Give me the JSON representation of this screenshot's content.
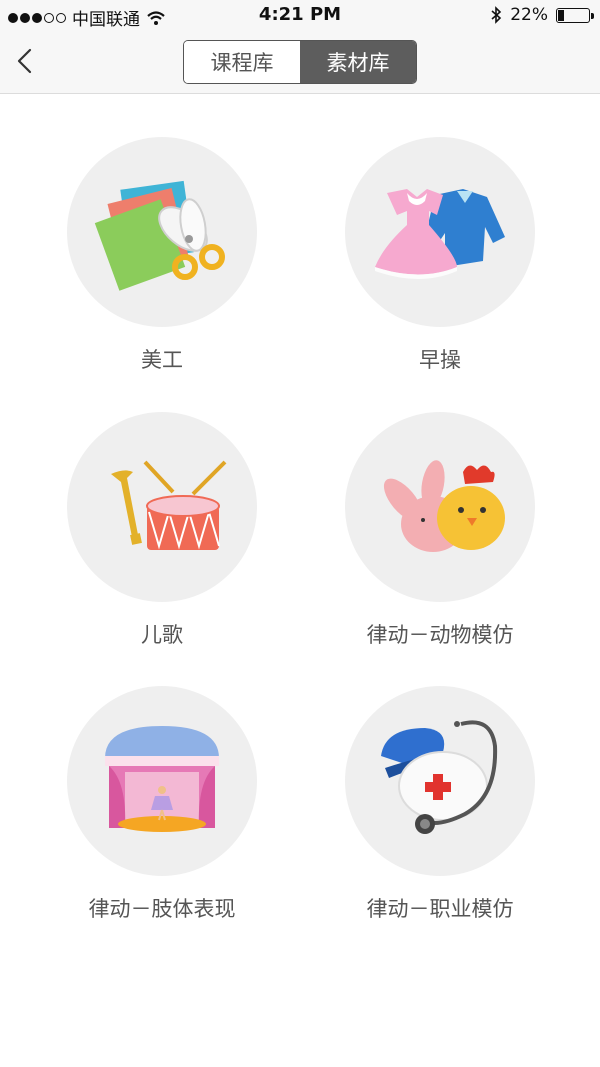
{
  "status_bar": {
    "carrier": "中国联通",
    "time": "4:21 PM",
    "battery": "22%",
    "battery_level": 0.22,
    "icons": [
      "signal-dots-icon",
      "wifi-icon",
      "bluetooth-icon",
      "battery-icon"
    ]
  },
  "nav": {
    "back_icon": "chevron-left-icon",
    "tabs": [
      {
        "label": "课程库",
        "selected": false
      },
      {
        "label": "素材库",
        "selected": true
      }
    ]
  },
  "grid": {
    "items": [
      {
        "label": "美工",
        "icon": "art-paper-scissors-icon"
      },
      {
        "label": "早操",
        "icon": "clothes-icon"
      },
      {
        "label": "儿歌",
        "icon": "trumpet-drum-icon"
      },
      {
        "label": "律动－动物模仿",
        "icon": "rabbit-chick-icon"
      },
      {
        "label": "律动－肢体表现",
        "icon": "stage-dancer-icon"
      },
      {
        "label": "律动－职业模仿",
        "icon": "doctor-kit-icon"
      }
    ]
  },
  "colors": {
    "bar_bg": "#f7f7f7",
    "circle_bg": "#efefef",
    "segment_selected": "#5d5d5d",
    "label_text": "#555555"
  }
}
